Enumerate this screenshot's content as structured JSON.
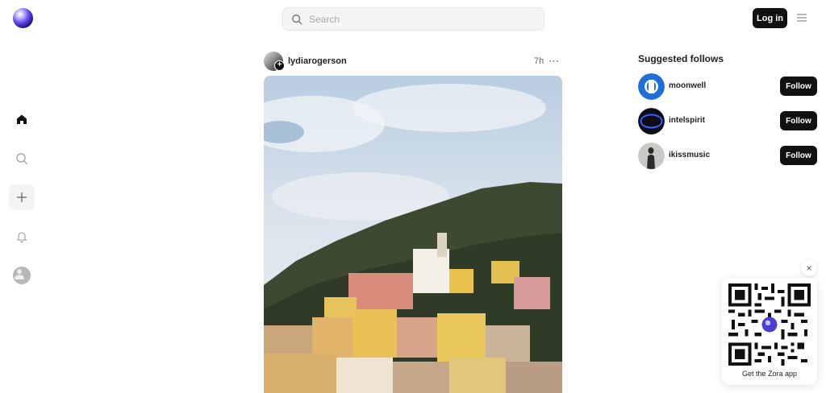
{
  "header": {
    "search_placeholder": "Search",
    "login_label": "Log in"
  },
  "sidebar": {
    "items": [
      {
        "name": "home",
        "icon": "home-icon"
      },
      {
        "name": "search",
        "icon": "search-icon"
      },
      {
        "name": "create",
        "icon": "plus-icon"
      },
      {
        "name": "notifications",
        "icon": "bell-icon"
      },
      {
        "name": "profile",
        "icon": "avatar"
      }
    ]
  },
  "post": {
    "username": "lydiaroger­son",
    "time": "7h",
    "more": "⋯"
  },
  "suggested": {
    "title": "Suggested follows",
    "follow_label": "Follow",
    "accounts": [
      {
        "name": "moonwell"
      },
      {
        "name": "intelspirit"
      },
      {
        "name": "ikissmusic"
      }
    ]
  },
  "qr": {
    "close": "×",
    "label": "Get the Zora app"
  },
  "colors": {
    "button_bg": "#111111",
    "accent_blue": "#1f6fd6"
  }
}
